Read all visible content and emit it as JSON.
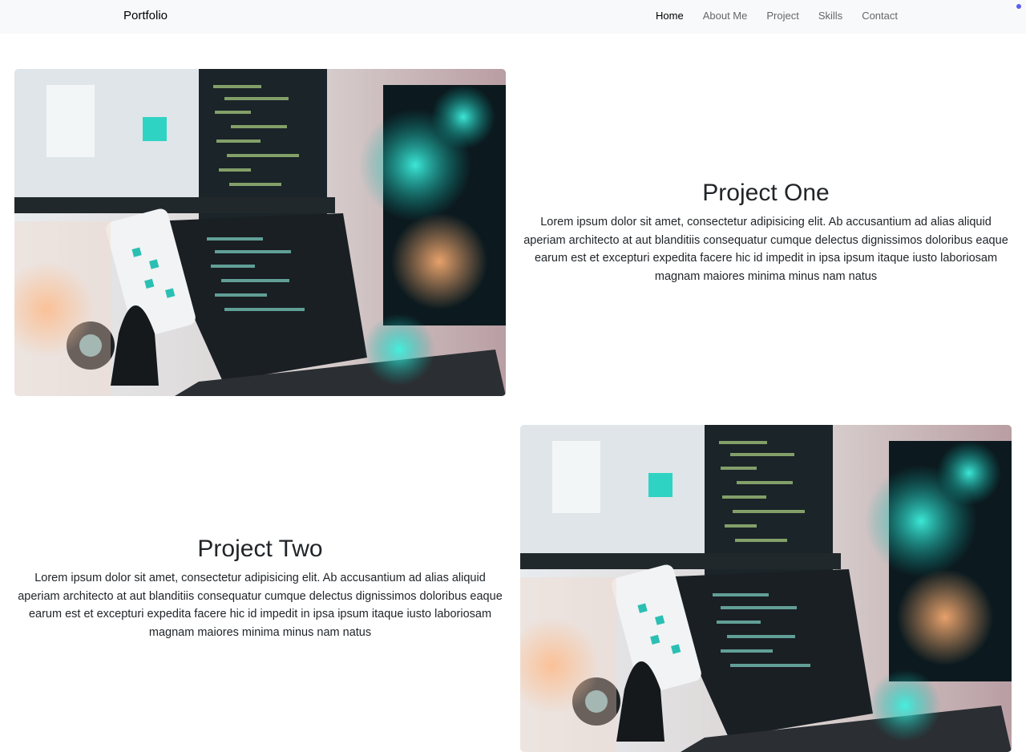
{
  "navbar": {
    "brand": "Portfolio",
    "links": [
      {
        "label": "Home",
        "active": true
      },
      {
        "label": "About Me",
        "active": false
      },
      {
        "label": "Project",
        "active": false
      },
      {
        "label": "Skills",
        "active": false
      },
      {
        "label": "Contact",
        "active": false
      }
    ]
  },
  "projects": [
    {
      "title": "Project One",
      "description": "Lorem ipsum dolor sit amet, consectetur adipisicing elit. Ab accusantium ad alias aliquid aperiam architecto at aut blanditiis consequatur cumque delectus dignissimos doloribus eaque earum est et excepturi expedita facere hic id impedit in ipsa ipsum itaque iusto laboriosam magnam maiores minima minus nam natus"
    },
    {
      "title": "Project Two",
      "description": "Lorem ipsum dolor sit amet, consectetur adipisicing elit. Ab accusantium ad alias aliquid aperiam architecto at aut blanditiis consequatur cumque delectus dignissimos doloribus eaque earum est et excepturi expedita facere hic id impedit in ipsa ipsum itaque iusto laboriosam magnam maiores minima minus nam natus"
    }
  ],
  "colors": {
    "navbar_bg": "#f8f9fa",
    "indicator_dot": "#5b5ef2"
  }
}
